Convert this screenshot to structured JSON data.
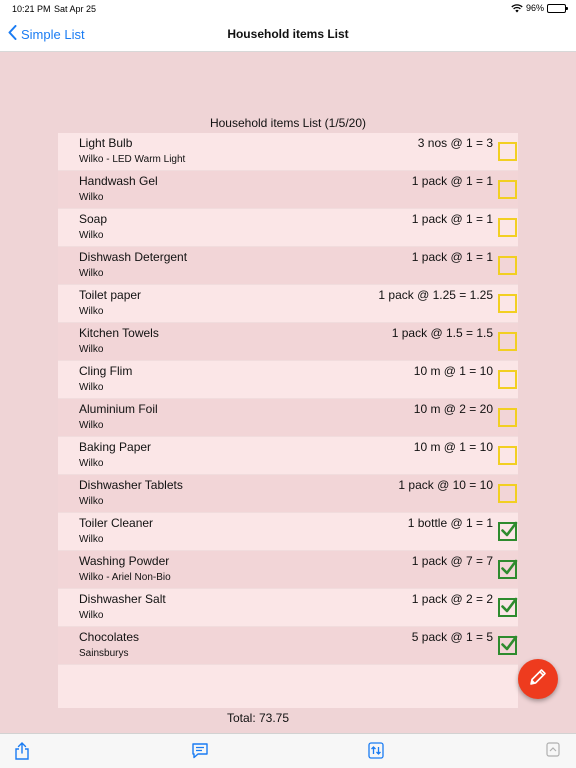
{
  "status_bar": {
    "time": "10:21 PM",
    "date": "Sat Apr 25",
    "battery": "96%"
  },
  "nav": {
    "back_label": "Simple List",
    "title": "Household items List"
  },
  "list": {
    "title": "Household items List (1/5/20)",
    "items": [
      {
        "name": "Light Bulb",
        "shop": "Wilko - LED Warm Light",
        "qty": "3 nos @ 1 = 3",
        "checked": false
      },
      {
        "name": "Handwash Gel",
        "shop": "Wilko",
        "qty": "1 pack @ 1 = 1",
        "checked": false
      },
      {
        "name": "Soap",
        "shop": "Wilko",
        "qty": "1 pack @ 1 = 1",
        "checked": false
      },
      {
        "name": "Dishwash Detergent",
        "shop": "Wilko",
        "qty": "1 pack @ 1 = 1",
        "checked": false
      },
      {
        "name": "Toilet paper",
        "shop": "Wilko",
        "qty": "1 pack @ 1.25 = 1.25",
        "checked": false
      },
      {
        "name": "Kitchen Towels",
        "shop": "Wilko",
        "qty": "1 pack @ 1.5 = 1.5",
        "checked": false
      },
      {
        "name": "Cling Flim",
        "shop": "Wilko",
        "qty": "10 m @ 1 = 10",
        "checked": false
      },
      {
        "name": "Aluminium Foil",
        "shop": "Wilko",
        "qty": "10 m @ 2 = 20",
        "checked": false
      },
      {
        "name": "Baking Paper",
        "shop": "Wilko",
        "qty": "10 m @ 1 = 10",
        "checked": false
      },
      {
        "name": "Dishwasher Tablets",
        "shop": "Wilko",
        "qty": "1 pack @ 10 = 10",
        "checked": false
      },
      {
        "name": "Toiler Cleaner",
        "shop": "Wilko",
        "qty": "1 bottle @ 1 = 1",
        "checked": true
      },
      {
        "name": "Washing Powder",
        "shop": "Wilko - Ariel Non-Bio",
        "qty": "1 pack @ 7 = 7",
        "checked": true
      },
      {
        "name": "Dishwasher Salt",
        "shop": "Wilko",
        "qty": "1 pack @ 2 = 2",
        "checked": true
      },
      {
        "name": "Chocolates",
        "shop": "Sainsburys",
        "qty": "5 pack @ 1 = 5",
        "checked": true
      }
    ],
    "total": "Total:  73.75"
  },
  "colors": {
    "accent": "#1a7cf3",
    "checkbox_unchecked": "#f2cf22",
    "checkbox_checked": "#2e8b2e",
    "fab": "#ee3b1e",
    "background": "#efd4d6"
  },
  "icons": {
    "back": "chevron-left-icon",
    "fab": "pencil-icon",
    "toolbar": [
      "share-icon",
      "message-icon",
      "sort-icon",
      "scroll-top-icon"
    ]
  }
}
